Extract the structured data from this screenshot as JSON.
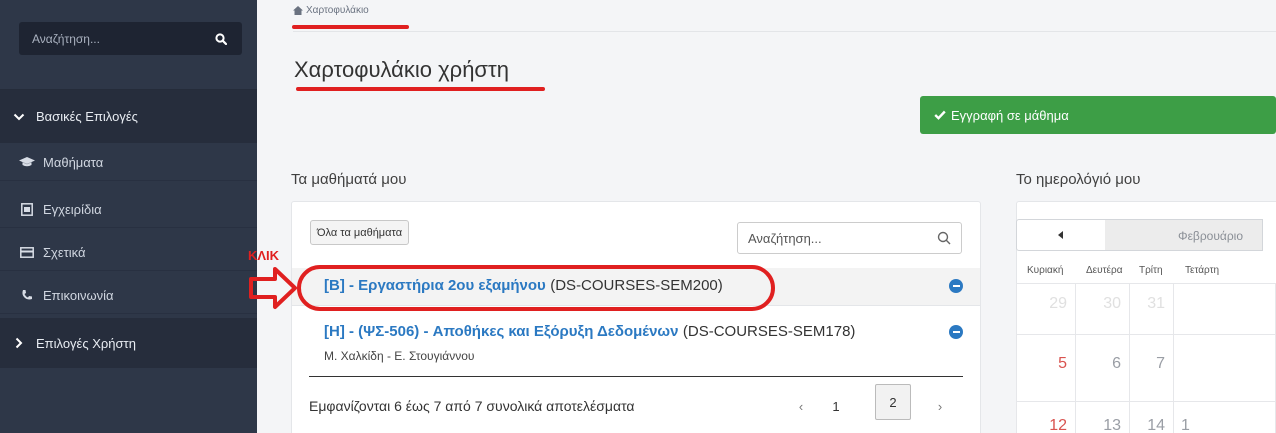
{
  "sidebar": {
    "search_placeholder": "Αναζήτηση...",
    "sections": [
      {
        "label": "Βασικές Επιλογές",
        "expanded": true
      },
      {
        "label": "Επιλογές Χρήστη",
        "expanded": false
      }
    ],
    "items": [
      {
        "label": "Μαθήματα",
        "icon": "graduation-cap-icon"
      },
      {
        "label": "Εγχειρίδια",
        "icon": "manual-icon"
      },
      {
        "label": "Σχετικά",
        "icon": "card-icon"
      },
      {
        "label": "Επικοινωνία",
        "icon": "phone-icon"
      }
    ]
  },
  "header": {
    "breadcrumb": "Χαρτοφυλάκιο",
    "title": "Χαρτοφυλάκιο χρήστη",
    "enroll_button": "Εγγραφή σε μάθημα"
  },
  "courses": {
    "title": "Τα μαθήματά μου",
    "all_button": "Όλα τα μαθήματα",
    "search_placeholder": "Αναζήτηση...",
    "rows": [
      {
        "name": "[B] - Εργαστήρια 2ου εξαμήνου",
        "code": "(DS-COURSES-SEM200)",
        "subtitle": ""
      },
      {
        "name": "[H] - (ΨΣ-506) - Αποθήκες και Εξόρυξη Δεδομένων",
        "code": "(DS-COURSES-SEM178)",
        "subtitle": "Μ. Χαλκίδη - Ε. Στουγιάννου"
      }
    ],
    "results_text": "Εμφανίζονται 6 έως 7 από 7 συνολικά αποτελέσματα",
    "pagination": {
      "prev": "‹",
      "pages": [
        "1",
        "2"
      ],
      "next": "›",
      "current": "2"
    }
  },
  "calendar": {
    "title": "Το ημερολόγιό μου",
    "month": "Φεβρουάριο",
    "days_of_week": [
      "Κυριακή",
      "Δευτέρα",
      "Τρίτη",
      "Τετάρτη"
    ],
    "rows": [
      [
        "29",
        "30",
        "31",
        ""
      ],
      [
        "5",
        "6",
        "7",
        ""
      ],
      [
        "12",
        "13",
        "14",
        "1"
      ]
    ]
  },
  "annotation": {
    "click_label": "ΚΛΙΚ",
    "color": "#e02020"
  },
  "colors": {
    "sidebar_bg": "#2e3748",
    "accent": "#2b79c2",
    "enroll_green": "#3d9e46"
  }
}
